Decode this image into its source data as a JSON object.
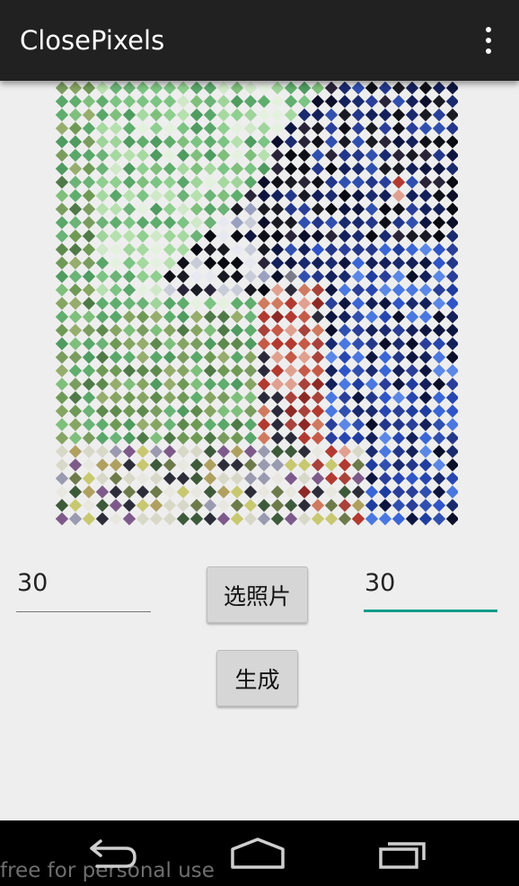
{
  "app": {
    "title": "ClosePixels"
  },
  "colors": {
    "action_bar": "#212121",
    "accent": "#0f9d8a",
    "background": "#eeeeee",
    "nav_bar": "#000000"
  },
  "inputs": {
    "left_value": "30",
    "right_value": "30"
  },
  "buttons": {
    "select_photo": "选照片",
    "generate": "生成"
  },
  "icons": {
    "overflow": "more-vertical-icon",
    "back": "back-icon",
    "home": "home-icon",
    "recents": "recents-icon"
  },
  "watermark": "free for personal use"
}
